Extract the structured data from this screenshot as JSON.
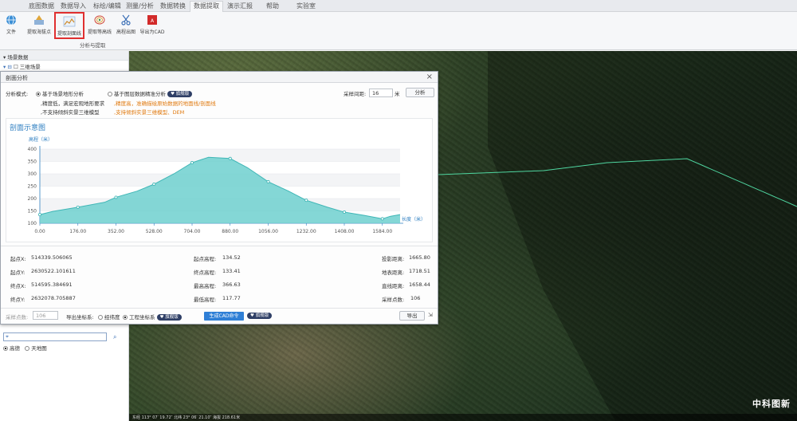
{
  "ribbon": {
    "tabs": [
      "底图数据",
      "数据导入",
      "标绘/编辑",
      "测量/分析",
      "数据转换",
      "数据提取",
      "演示汇报",
      "帮助",
      "实验室"
    ],
    "active_tab_index": 5,
    "file_label": "文件",
    "buttons": [
      "提取海拔点",
      "提取剖面线",
      "提取等高线",
      "高程出图",
      "导出为CAD"
    ],
    "selected_button_index": 1,
    "group_label": "分析与提取"
  },
  "left_panel": {
    "header": "场景数据",
    "tree_root": "三维场景",
    "search_placeholder": "",
    "source_options": [
      "高德",
      "天地图"
    ],
    "selected_source_index": 0
  },
  "dialog": {
    "title": "剖面分析",
    "analysis_mode_label": "分析模式:",
    "mode_a": "基于场景地形分析",
    "mode_b": "基于图层数据精准分析",
    "mode_b_badge": "旗舰版",
    "mode_a_notes": [
      ",精度低，满足宏观地形要求",
      ",不支持倾斜实景三维模型"
    ],
    "mode_b_notes": [
      ",精度高，准确描绘原始数据的地面线/剖面线",
      ",支持倾斜实景三维模型、DEM"
    ],
    "sample_interval_label": "采样间距:",
    "sample_interval_value": "16",
    "sample_interval_unit": "米",
    "analyze_button": "分析",
    "chart_panel_title": "剖面示意图",
    "stats": {
      "start_x_label": "起点X:",
      "start_x": "514339.506065",
      "start_y_label": "起点Y:",
      "start_y": "2630522.101611",
      "end_x_label": "终点X:",
      "end_x": "514595.384691",
      "end_y_label": "终点Y:",
      "end_y": "2632078.705887",
      "start_elev_label": "起点高程:",
      "start_elev": "134.52",
      "end_elev_label": "终点高程:",
      "end_elev": "133.41",
      "max_elev_label": "最高高程:",
      "max_elev": "366.63",
      "min_elev_label": "最低高程:",
      "min_elev": "117.77",
      "proj_dist_label": "投影距离:",
      "proj_dist": "1665.80",
      "surface_dist_label": "地表距离:",
      "surface_dist": "1718.51",
      "straight_dist_label": "直线距离:",
      "straight_dist": "1658.44",
      "sample_count_label": "采样点数:",
      "sample_count": "106"
    },
    "bottom": {
      "sample_points_label": "采样点数:",
      "sample_points_value": "106",
      "export_coord_label": "导出坐标系:",
      "coord_option_a": "经纬度",
      "coord_option_b": "工程坐标系",
      "coord_badge": "旗舰版",
      "cad_button": "生成CAD命令",
      "cad_badge": "旗舰版",
      "export_button": "导出"
    }
  },
  "map": {
    "watermark": "中科图新",
    "status_text": "东经 113° 07′ 19.72″  北纬 23° 06′ 21.10″  海拔 218.61米"
  },
  "chart_data": {
    "type": "area",
    "title": "剖面示意图",
    "ylabel": "高程（米）",
    "xlabel": "长度（米）",
    "x_ticks": [
      0,
      176,
      352,
      528,
      704,
      880,
      1056,
      1232,
      1408,
      1584
    ],
    "x_tick_labels": [
      "0.00",
      "176.00",
      "352.00",
      "528.00",
      "704.00",
      "880.00",
      "1056.00",
      "1232.00",
      "1408.00",
      "1584.00"
    ],
    "y_ticks": [
      100,
      150,
      200,
      250,
      300,
      350,
      400
    ],
    "xlim": [
      0,
      1666
    ],
    "ylim": [
      100,
      400
    ],
    "x": [
      0,
      60,
      176,
      300,
      352,
      450,
      528,
      620,
      704,
      780,
      880,
      960,
      1056,
      1150,
      1232,
      1330,
      1408,
      1500,
      1584,
      1620,
      1666
    ],
    "values": [
      135,
      148,
      165,
      185,
      205,
      230,
      258,
      300,
      345,
      367,
      362,
      325,
      268,
      230,
      193,
      165,
      145,
      132,
      118,
      128,
      135
    ],
    "marker_x": [
      0,
      176,
      352,
      528,
      704,
      880,
      1056,
      1232,
      1408,
      1584
    ],
    "fill_color": "#6fd0cf",
    "line_color": "#3fb6b6",
    "grid": true
  }
}
